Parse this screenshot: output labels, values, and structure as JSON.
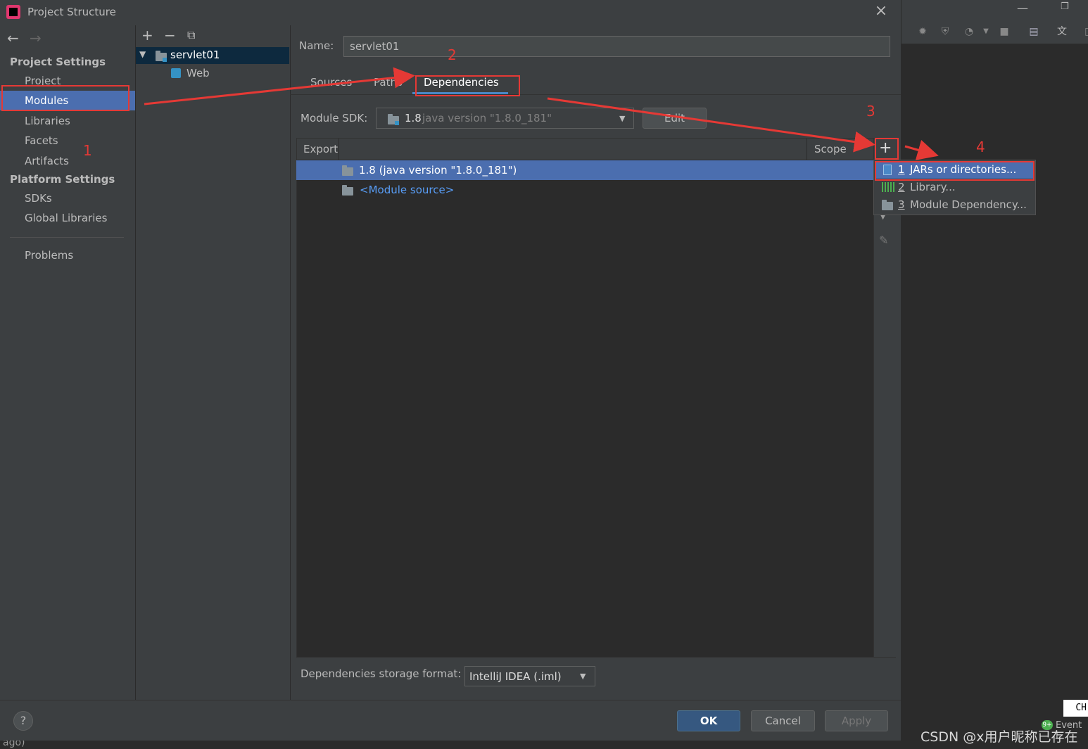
{
  "window": {
    "title": "Project Structure"
  },
  "nav": {
    "project_settings": "Project Settings",
    "items_project": [
      "Project",
      "Modules",
      "Libraries",
      "Facets",
      "Artifacts"
    ],
    "platform_settings": "Platform Settings",
    "items_platform": [
      "SDKs",
      "Global Libraries"
    ],
    "problems": "Problems",
    "selected": "Modules"
  },
  "tree": {
    "module": "servlet01",
    "child": "Web"
  },
  "main": {
    "name_label": "Name:",
    "name_value": "servlet01",
    "tabs": [
      "Sources",
      "Paths",
      "Dependencies"
    ],
    "active_tab": "Dependencies",
    "sdk_label": "Module SDK:",
    "sdk_version": "1.8",
    "sdk_detail": "java version \"1.8.0_181\"",
    "edit_button": "Edit",
    "col_export": "Export",
    "col_scope": "Scope",
    "rows": [
      "1.8 (java version \"1.8.0_181\")",
      "<Module source>"
    ],
    "storage_label": "Dependencies storage format:",
    "storage_value": "IntelliJ IDEA (.iml)"
  },
  "popup": {
    "items": [
      {
        "num": "1",
        "label": "JARs or directories..."
      },
      {
        "num": "2",
        "label": "Library..."
      },
      {
        "num": "3",
        "label": "Module Dependency..."
      }
    ]
  },
  "footer": {
    "ok": "OK",
    "cancel": "Cancel",
    "apply": "Apply",
    "help": "?"
  },
  "annotations": [
    "1",
    "2",
    "3",
    "4"
  ],
  "background": {
    "status_ch": "CH",
    "event_badge": "9+",
    "event_label": "Event L",
    "bottom_left": "ago)",
    "watermark": "CSDN @x用户昵称已存在"
  },
  "colors": {
    "selection": "#4b6eaf",
    "annotation": "#e53935",
    "link": "#589df6"
  }
}
